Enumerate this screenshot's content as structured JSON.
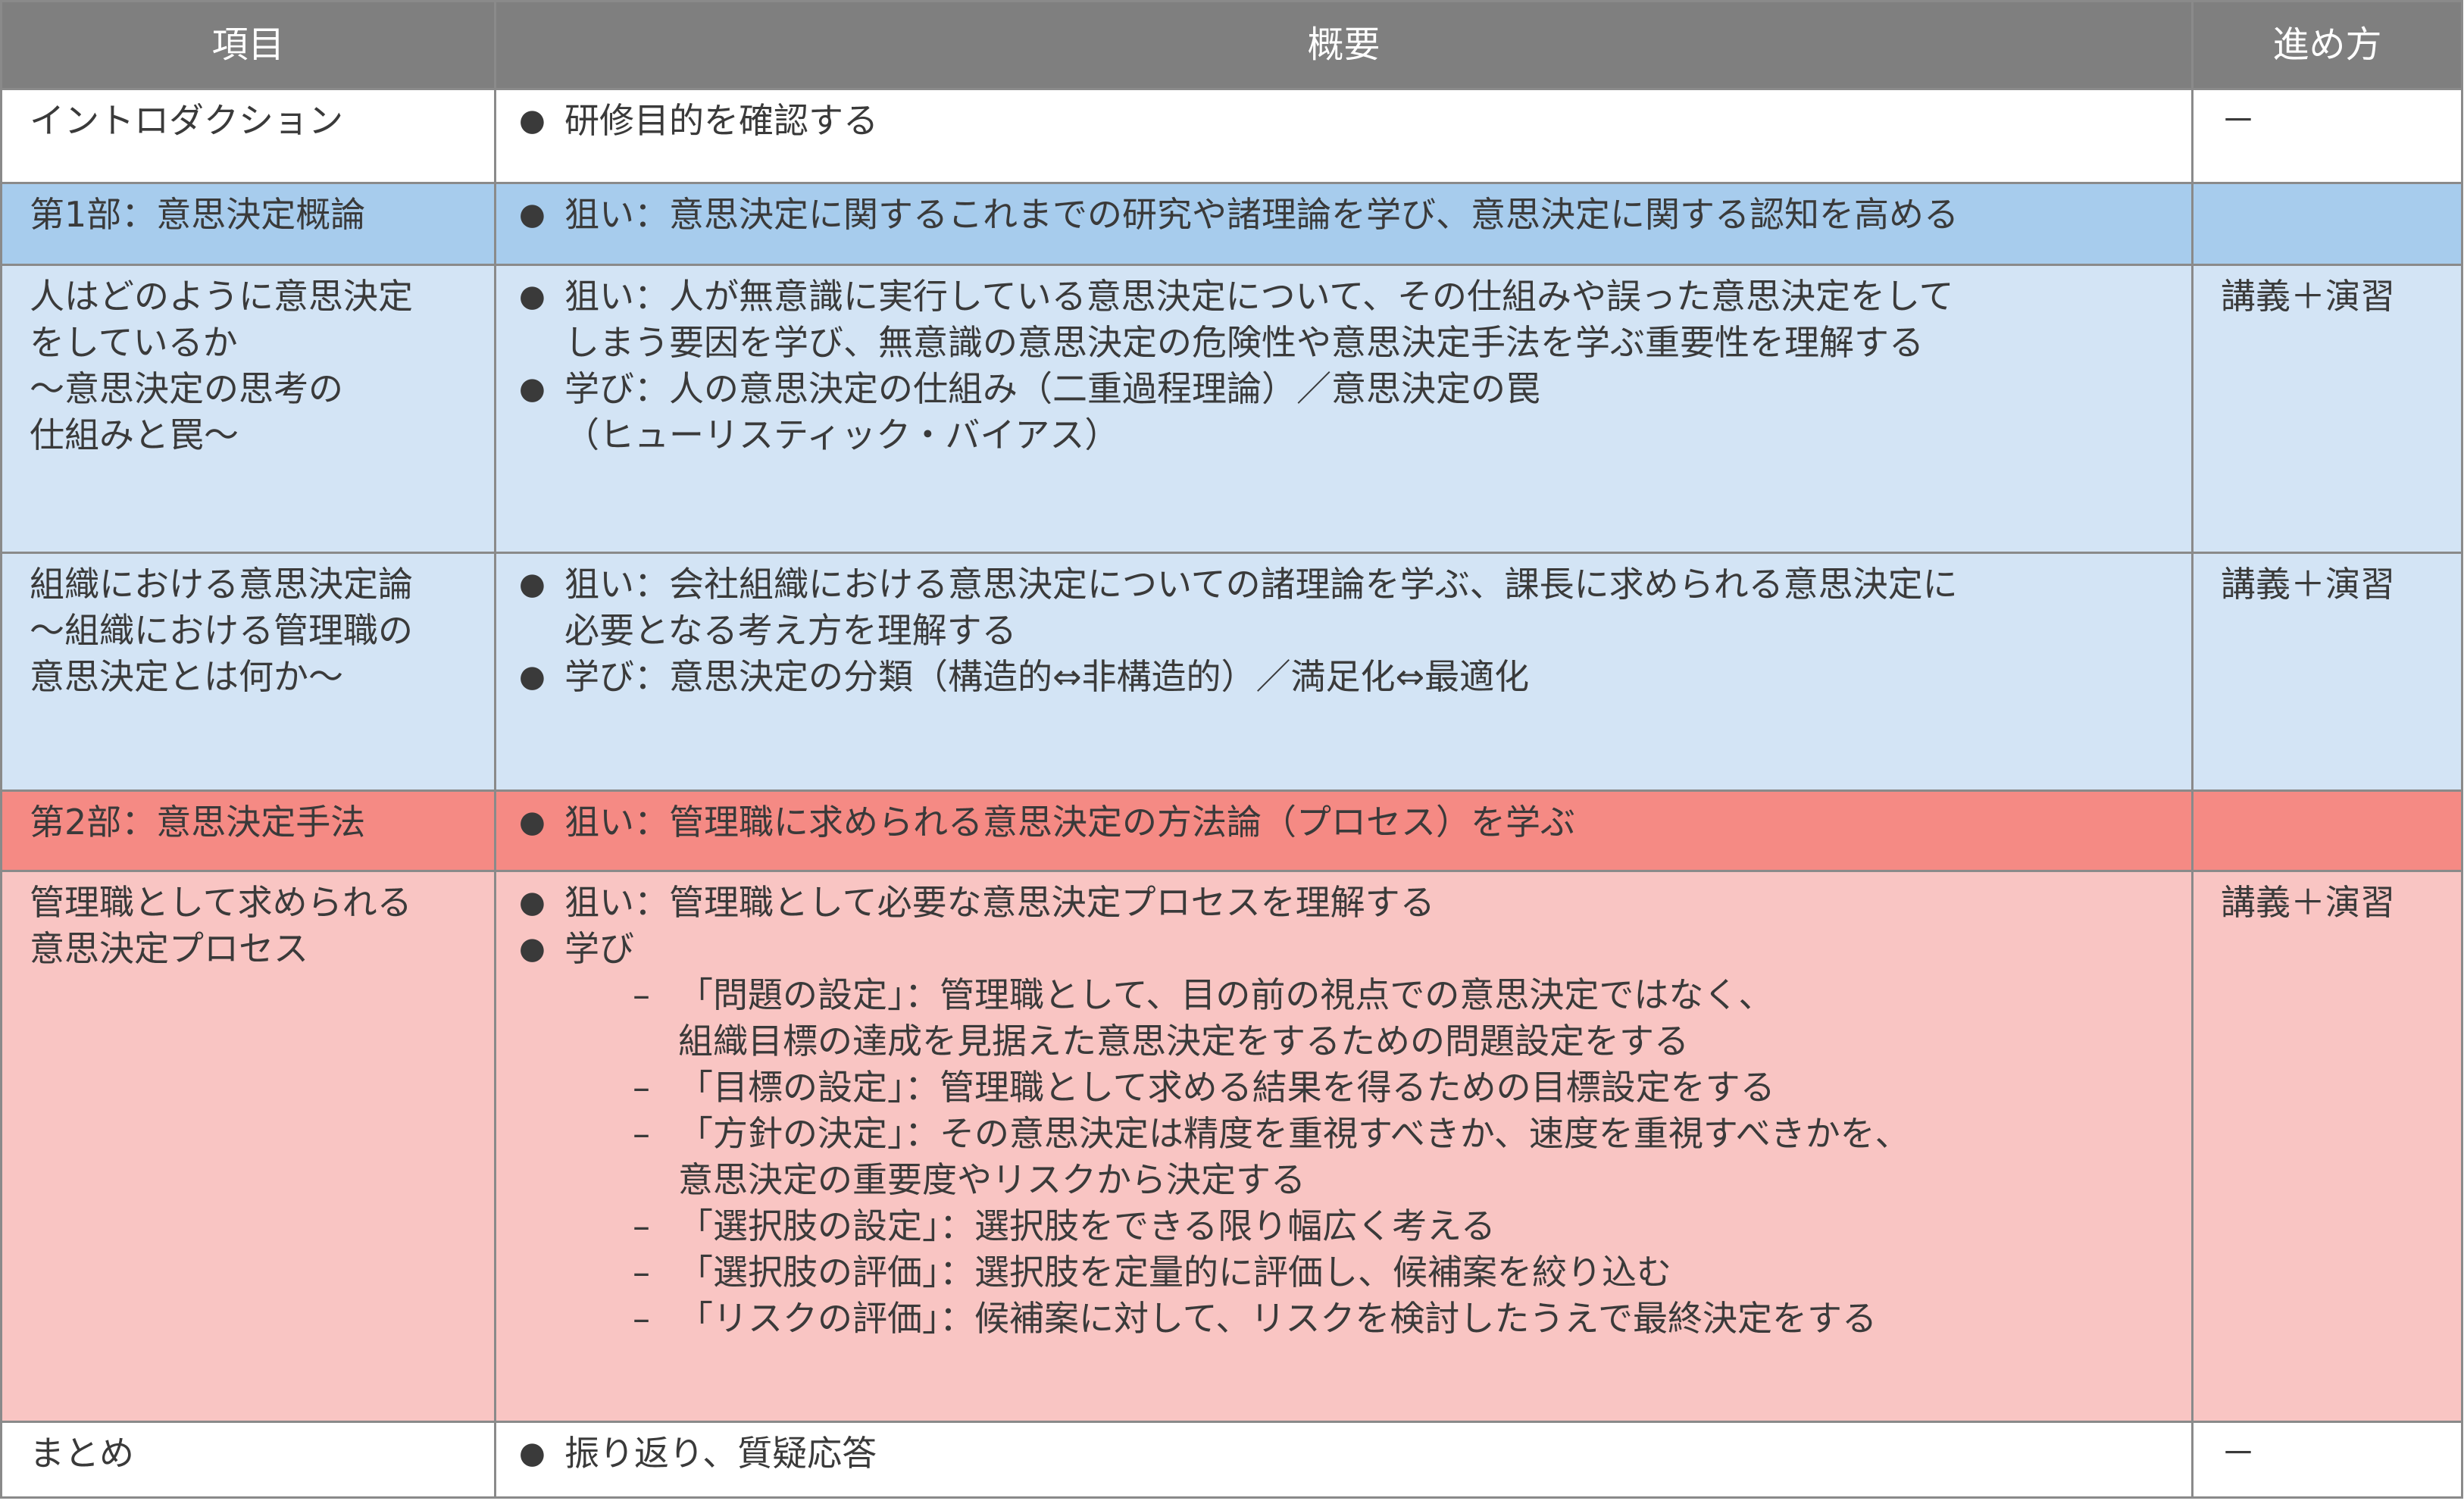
{
  "header": {
    "col1": "項目",
    "col2": "概要",
    "col3": "進め方"
  },
  "rows": [
    {
      "item": "イントロダクション",
      "bullets": [
        {
          "text": "研修目的を確認する"
        }
      ],
      "method": "－"
    },
    {
      "item": "第1部：意思決定概論",
      "bullets": [
        {
          "text": "狙い：意思決定に関するこれまでの研究や諸理論を学び、意思決定に関する認知を高める"
        }
      ],
      "method": ""
    },
    {
      "item": "人はどのように意思決定\nをしているか\n～意思決定の思考の\n仕組みと罠～",
      "bullets": [
        {
          "text": "狙い：人が無意識に実行している意思決定について、その仕組みや誤った意思決定をして\nしまう要因を学び、無意識の意思決定の危険性や意思決定手法を学ぶ重要性を理解する"
        },
        {
          "text": "学び：人の意思決定の仕組み（二重過程理論）／意思決定の罠\n（ヒューリスティック・バイアス）"
        }
      ],
      "method": "講義＋演習"
    },
    {
      "item": "組織における意思決定論\n～組織における管理職の\n意思決定とは何か～",
      "bullets": [
        {
          "text": "狙い：会社組織における意思決定についての諸理論を学ぶ、課長に求められる意思決定に\n必要となる考え方を理解する"
        },
        {
          "text": "学び：意思決定の分類（構造的⇔非構造的）／満足化⇔最適化"
        }
      ],
      "method": "講義＋演習"
    },
    {
      "item": "第2部：意思決定手法",
      "bullets": [
        {
          "text": "狙い：管理職に求められる意思決定の方法論（プロセス）を学ぶ"
        }
      ],
      "method": ""
    },
    {
      "item": "管理職として求められる\n意思決定プロセス",
      "bullets": [
        {
          "text": "狙い：管理職として必要な意思決定プロセスを理解する"
        },
        {
          "text": "学び"
        }
      ],
      "subbullets": [
        "「問題の設定」：管理職として、目の前の視点での意思決定ではなく、\n組織目標の達成を見据えた意思決定をするための問題設定をする",
        "「目標の設定」：管理職として求める結果を得るための目標設定をする",
        "「方針の決定」：その意思決定は精度を重視すべきか、速度を重視すべきかを、\n意思決定の重要度やリスクから決定する",
        "「選択肢の設定」：選択肢をできる限り幅広く考える",
        "「選択肢の評価」：選択肢を定量的に評価し、候補案を絞り込む",
        "「リスクの評価」：候補案に対して、リスクを検討したうえで最終決定をする"
      ],
      "method": "講義＋演習"
    },
    {
      "item": "まとめ",
      "bullets": [
        {
          "text": "振り返り、質疑応答"
        }
      ],
      "method": "－"
    }
  ],
  "glyphs": {
    "bullet": "●",
    "dash": "–"
  },
  "colors": {
    "header": "#7f7f7f",
    "part1": "#a7cced",
    "part1_rows": "#d3e4f5",
    "part2": "#f58a84",
    "part2_rows": "#f9c5c3"
  }
}
